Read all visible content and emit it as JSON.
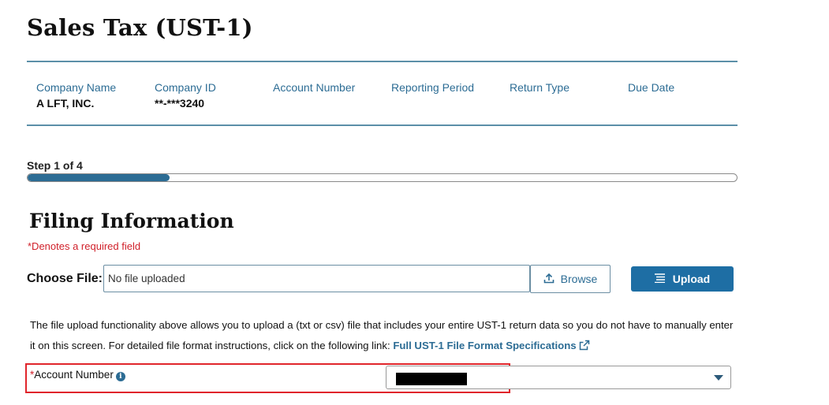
{
  "page": {
    "title": "Sales Tax (UST-1)"
  },
  "info": {
    "columns": [
      {
        "label": "Company Name",
        "value": "A LFT, INC."
      },
      {
        "label": "Company ID",
        "value": "**-***3240"
      },
      {
        "label": "Account Number",
        "value": ""
      },
      {
        "label": "Reporting Period",
        "value": ""
      },
      {
        "label": "Return Type",
        "value": ""
      },
      {
        "label": "Due Date",
        "value": ""
      }
    ]
  },
  "progress": {
    "label": "Step 1 of 4",
    "current_step": 1,
    "total_steps": 4,
    "fraction": 0.2
  },
  "section": {
    "title": "Filing Information",
    "required_note": "*Denotes a required field"
  },
  "file_upload": {
    "label": "Choose File:",
    "placeholder": "No file uploaded",
    "browse_label": "Browse",
    "upload_label": "Upload"
  },
  "help": {
    "text": "The file upload functionality above allows you to upload a (txt or csv) file that includes your entire UST-1 return data so you do not have to manually enter it on this screen. For detailed file format instructions, click on the following link: ",
    "link_text": "Full UST-1 File Format Specifications"
  },
  "account_field": {
    "required_mark": "*",
    "label": "Account Number",
    "info_glyph": "i",
    "value_redacted": true
  },
  "colors": {
    "accent": "#1e6ea4",
    "link": "#2c6c94",
    "required": "#d0202a",
    "highlight": "#e0252b"
  }
}
